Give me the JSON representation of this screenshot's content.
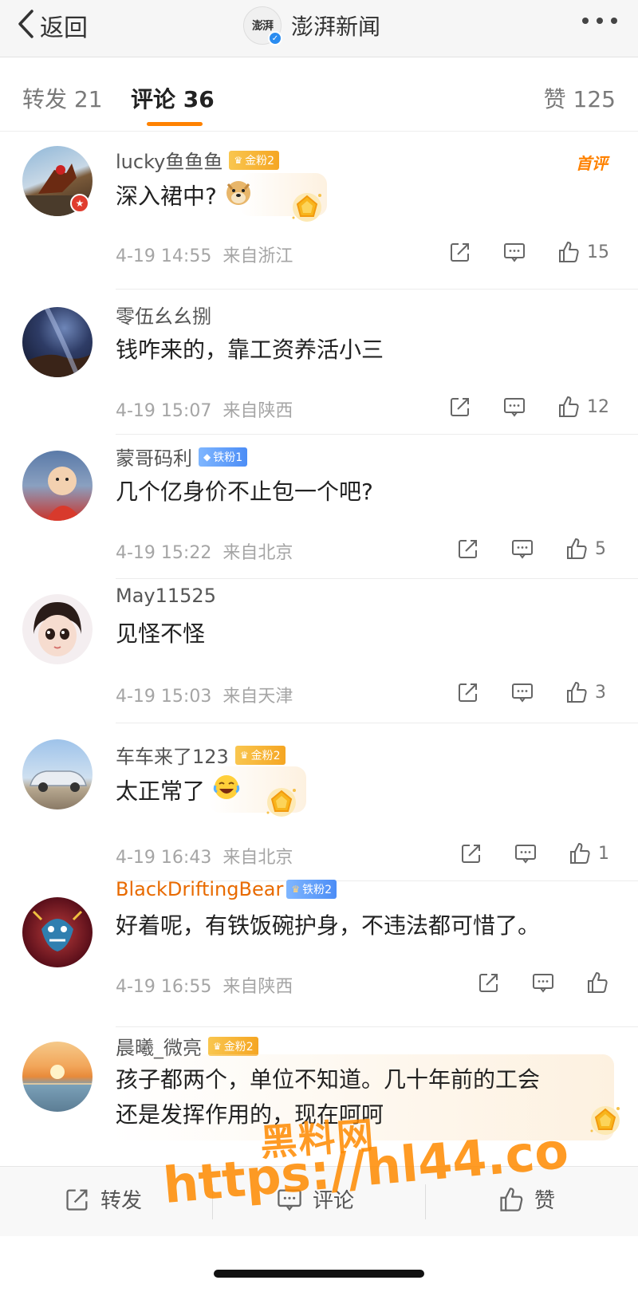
{
  "nav": {
    "back_label": "返回",
    "account_name": "澎湃新闻",
    "account_logo_text": "澎湃"
  },
  "tabs": {
    "repost": "转发 21",
    "comments": "评论 36",
    "likes": "赞 125"
  },
  "comments": [
    {
      "username": "lucky鱼鱼鱼",
      "badge": "金粉2",
      "badge_type": "gold",
      "text": "深入裙中?",
      "emoji": "doge",
      "first_tag": "首评",
      "time": "4-19 14:55",
      "location": "来自浙江",
      "likes": "15"
    },
    {
      "username": "零伍幺幺捌",
      "text": "钱咋来的，靠工资养活小三",
      "time": "4-19 15:07",
      "location": "来自陕西",
      "likes": "12"
    },
    {
      "username": "蒙哥码利",
      "badge": "铁粉1",
      "badge_type": "blue",
      "text": "几个亿身价不止包一个吧?",
      "time": "4-19 15:22",
      "location": "来自北京",
      "likes": "5"
    },
    {
      "username": "May11525",
      "text": "见怪不怪",
      "time": "4-19 15:03",
      "location": "来自天津",
      "likes": "3"
    },
    {
      "username": "车车来了123",
      "badge": "金粉2",
      "badge_type": "gold",
      "text": "太正常了",
      "emoji": "laugh-cry",
      "time": "4-19 16:43",
      "location": "来自北京",
      "likes": "1"
    },
    {
      "username": "BlackDriftingBear",
      "badge": "铁粉2",
      "badge_type": "blue",
      "text": "好着呢，有铁饭碗护身，不违法都可惜了。",
      "time": "4-19 16:55",
      "location": "来自陕西",
      "likes": ""
    },
    {
      "username": "晨曦_微亮",
      "badge": "金粉2",
      "badge_type": "gold",
      "text_line1": "孩子都两个，单位不知道。几十年前的工会",
      "text_line2": "还是发挥作用的，现在呵呵"
    }
  ],
  "bottom_bar": {
    "repost": "转发",
    "comment": "评论",
    "like": "赞"
  },
  "watermark": {
    "line1": "黑料网",
    "line2": "https://hl44.co"
  },
  "colors": {
    "accent": "#ff8200",
    "verified": "#2a8cf0"
  }
}
